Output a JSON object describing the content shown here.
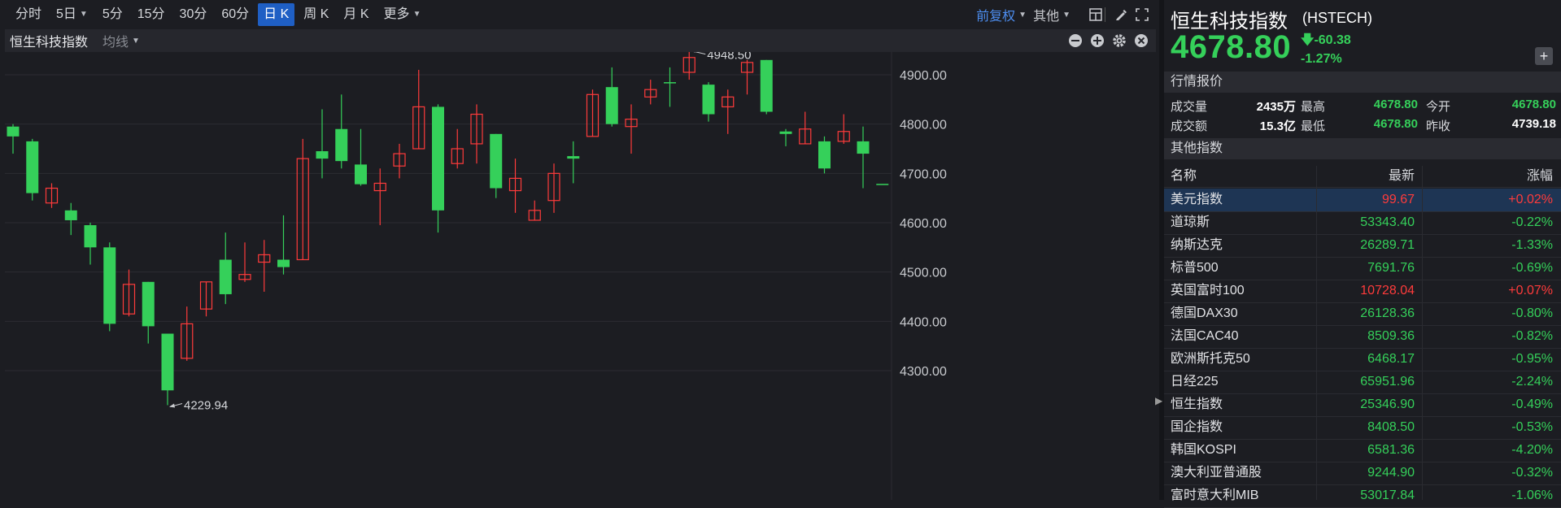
{
  "toolbar": {
    "periods": [
      {
        "label": "分时",
        "caret": false,
        "active": false
      },
      {
        "label": "5日",
        "caret": true,
        "active": false
      },
      {
        "label": "5分",
        "caret": false,
        "active": false
      },
      {
        "label": "15分",
        "caret": false,
        "active": false
      },
      {
        "label": "30分",
        "caret": false,
        "active": false
      },
      {
        "label": "60分",
        "caret": false,
        "active": false
      },
      {
        "label": "日 K",
        "caret": false,
        "active": true
      },
      {
        "label": "周 K",
        "caret": false,
        "active": false
      },
      {
        "label": "月 K",
        "caret": false,
        "active": false
      },
      {
        "label": "更多",
        "caret": true,
        "active": false
      }
    ],
    "adjust_label": "前复权",
    "other_label": "其他"
  },
  "chart_header": {
    "title": "恒生科技指数",
    "ma_label": "均线"
  },
  "chart_data": {
    "type": "candlestick",
    "y_ticks": [
      "4900.00",
      "4800.00",
      "4700.00",
      "4600.00",
      "4500.00",
      "4400.00",
      "4300.00"
    ],
    "y_tick_values": [
      4900,
      4800,
      4700,
      4600,
      4500,
      4400,
      4300
    ],
    "ylim": [
      4224,
      4965
    ],
    "high_annotation": "4948.50",
    "low_annotation": "4229.94",
    "candles": [
      {
        "o": 4795,
        "c": 4775,
        "h": 4800,
        "l": 4740
      },
      {
        "o": 4765,
        "c": 4660,
        "h": 4770,
        "l": 4645
      },
      {
        "o": 4640,
        "c": 4670,
        "h": 4680,
        "l": 4630
      },
      {
        "o": 4625,
        "c": 4605,
        "h": 4640,
        "l": 4575
      },
      {
        "o": 4595,
        "c": 4550,
        "h": 4600,
        "l": 4515
      },
      {
        "o": 4550,
        "c": 4395,
        "h": 4560,
        "l": 4380
      },
      {
        "o": 4415,
        "c": 4475,
        "h": 4505,
        "l": 4410
      },
      {
        "o": 4480,
        "c": 4390,
        "h": 4480,
        "l": 4355
      },
      {
        "o": 4375,
        "c": 4260,
        "h": 4375,
        "l": 4230
      },
      {
        "o": 4325,
        "c": 4395,
        "h": 4430,
        "l": 4320
      },
      {
        "o": 4425,
        "c": 4480,
        "h": 4480,
        "l": 4410
      },
      {
        "o": 4525,
        "c": 4455,
        "h": 4580,
        "l": 4435
      },
      {
        "o": 4485,
        "c": 4495,
        "h": 4560,
        "l": 4480
      },
      {
        "o": 4520,
        "c": 4535,
        "h": 4565,
        "l": 4460
      },
      {
        "o": 4525,
        "c": 4510,
        "h": 4615,
        "l": 4495
      },
      {
        "o": 4525,
        "c": 4730,
        "h": 4770,
        "l": 4525
      },
      {
        "o": 4745,
        "c": 4730,
        "h": 4830,
        "l": 4690
      },
      {
        "o": 4790,
        "c": 4725,
        "h": 4860,
        "l": 4710
      },
      {
        "o": 4718,
        "c": 4678,
        "h": 4790,
        "l": 4675
      },
      {
        "o": 4665,
        "c": 4680,
        "h": 4710,
        "l": 4595
      },
      {
        "o": 4715,
        "c": 4740,
        "h": 4760,
        "l": 4690
      },
      {
        "o": 4750,
        "c": 4835,
        "h": 4910,
        "l": 4750
      },
      {
        "o": 4835,
        "c": 4625,
        "h": 4840,
        "l": 4580
      },
      {
        "o": 4720,
        "c": 4750,
        "h": 4790,
        "l": 4710
      },
      {
        "o": 4760,
        "c": 4820,
        "h": 4840,
        "l": 4720
      },
      {
        "o": 4780,
        "c": 4670,
        "h": 4780,
        "l": 4650
      },
      {
        "o": 4665,
        "c": 4690,
        "h": 4730,
        "l": 4620
      },
      {
        "o": 4605,
        "c": 4625,
        "h": 4645,
        "l": 4605
      },
      {
        "o": 4645,
        "c": 4700,
        "h": 4720,
        "l": 4620
      },
      {
        "o": 4735,
        "c": 4730,
        "h": 4765,
        "l": 4680
      },
      {
        "o": 4775,
        "c": 4860,
        "h": 4870,
        "l": 4775
      },
      {
        "o": 4875,
        "c": 4800,
        "h": 4915,
        "l": 4795
      },
      {
        "o": 4795,
        "c": 4810,
        "h": 4840,
        "l": 4740
      },
      {
        "o": 4855,
        "c": 4870,
        "h": 4890,
        "l": 4840
      },
      {
        "o": 4885,
        "c": 4884,
        "h": 4915,
        "l": 4835
      },
      {
        "o": 4905,
        "c": 4935,
        "h": 4948.5,
        "l": 4890
      },
      {
        "o": 4880,
        "c": 4820,
        "h": 4885,
        "l": 4805
      },
      {
        "o": 4835,
        "c": 4855,
        "h": 4870,
        "l": 4780
      },
      {
        "o": 4905,
        "c": 4925,
        "h": 4930,
        "l": 4860
      },
      {
        "o": 4930,
        "c": 4825,
        "h": 4930,
        "l": 4820
      },
      {
        "o": 4785,
        "c": 4780,
        "h": 4790,
        "l": 4755
      },
      {
        "o": 4760,
        "c": 4790,
        "h": 4825,
        "l": 4760
      },
      {
        "o": 4765,
        "c": 4710,
        "h": 4775,
        "l": 4700
      },
      {
        "o": 4765,
        "c": 4785,
        "h": 4820,
        "l": 4760
      },
      {
        "o": 4765,
        "c": 4740,
        "h": 4795,
        "l": 4670
      },
      {
        "o": 4678.8,
        "c": 4678.8,
        "h": 4678.8,
        "l": 4678.8
      }
    ]
  },
  "panel": {
    "name": "恒生科技指数",
    "code": "(HSTECH)",
    "price": "4678.80",
    "change": "-60.38",
    "change_pct": "-1.27%",
    "add_label": "+",
    "quote_title": "行情报价",
    "quote": {
      "volume_label": "成交量",
      "volume": "2435万",
      "high_label": "最高",
      "high": "4678.80",
      "open_label": "今开",
      "open": "4678.80",
      "amount_label": "成交额",
      "amount": "15.3亿",
      "low_label": "最低",
      "low": "4678.80",
      "prev_label": "昨收",
      "prev": "4739.18"
    },
    "others_title": "其他指数",
    "table_header": {
      "name": "名称",
      "last": "最新",
      "chg": "涨幅"
    },
    "rows": [
      {
        "name": "美元指数",
        "last": "99.67",
        "chg": "+0.02%",
        "up": true,
        "highlight": true
      },
      {
        "name": "道琼斯",
        "last": "53343.40",
        "chg": "-0.22%",
        "up": false
      },
      {
        "name": "纳斯达克",
        "last": "26289.71",
        "chg": "-1.33%",
        "up": false
      },
      {
        "name": "标普500",
        "last": "7691.76",
        "chg": "-0.69%",
        "up": false
      },
      {
        "name": "英国富时100",
        "last": "10728.04",
        "chg": "+0.07%",
        "up": true
      },
      {
        "name": "德国DAX30",
        "last": "26128.36",
        "chg": "-0.80%",
        "up": false
      },
      {
        "name": "法国CAC40",
        "last": "8509.36",
        "chg": "-0.82%",
        "up": false
      },
      {
        "name": "欧洲斯托克50",
        "last": "6468.17",
        "chg": "-0.95%",
        "up": false
      },
      {
        "name": "日经225",
        "last": "65951.96",
        "chg": "-2.24%",
        "up": false
      },
      {
        "name": "恒生指数",
        "last": "25346.90",
        "chg": "-0.49%",
        "up": false
      },
      {
        "name": "国企指数",
        "last": "8408.50",
        "chg": "-0.53%",
        "up": false
      },
      {
        "name": "韩国KOSPI",
        "last": "6581.36",
        "chg": "-4.20%",
        "up": false
      },
      {
        "name": "澳大利亚普通股",
        "last": "9244.90",
        "chg": "-0.32%",
        "up": false
      },
      {
        "name": "富时意大利MIB",
        "last": "53017.84",
        "chg": "-1.06%",
        "up": false
      }
    ],
    "colors": {
      "up": "#ff3b3b",
      "down": "#35d05a",
      "accent": "#1f5fc4"
    }
  }
}
